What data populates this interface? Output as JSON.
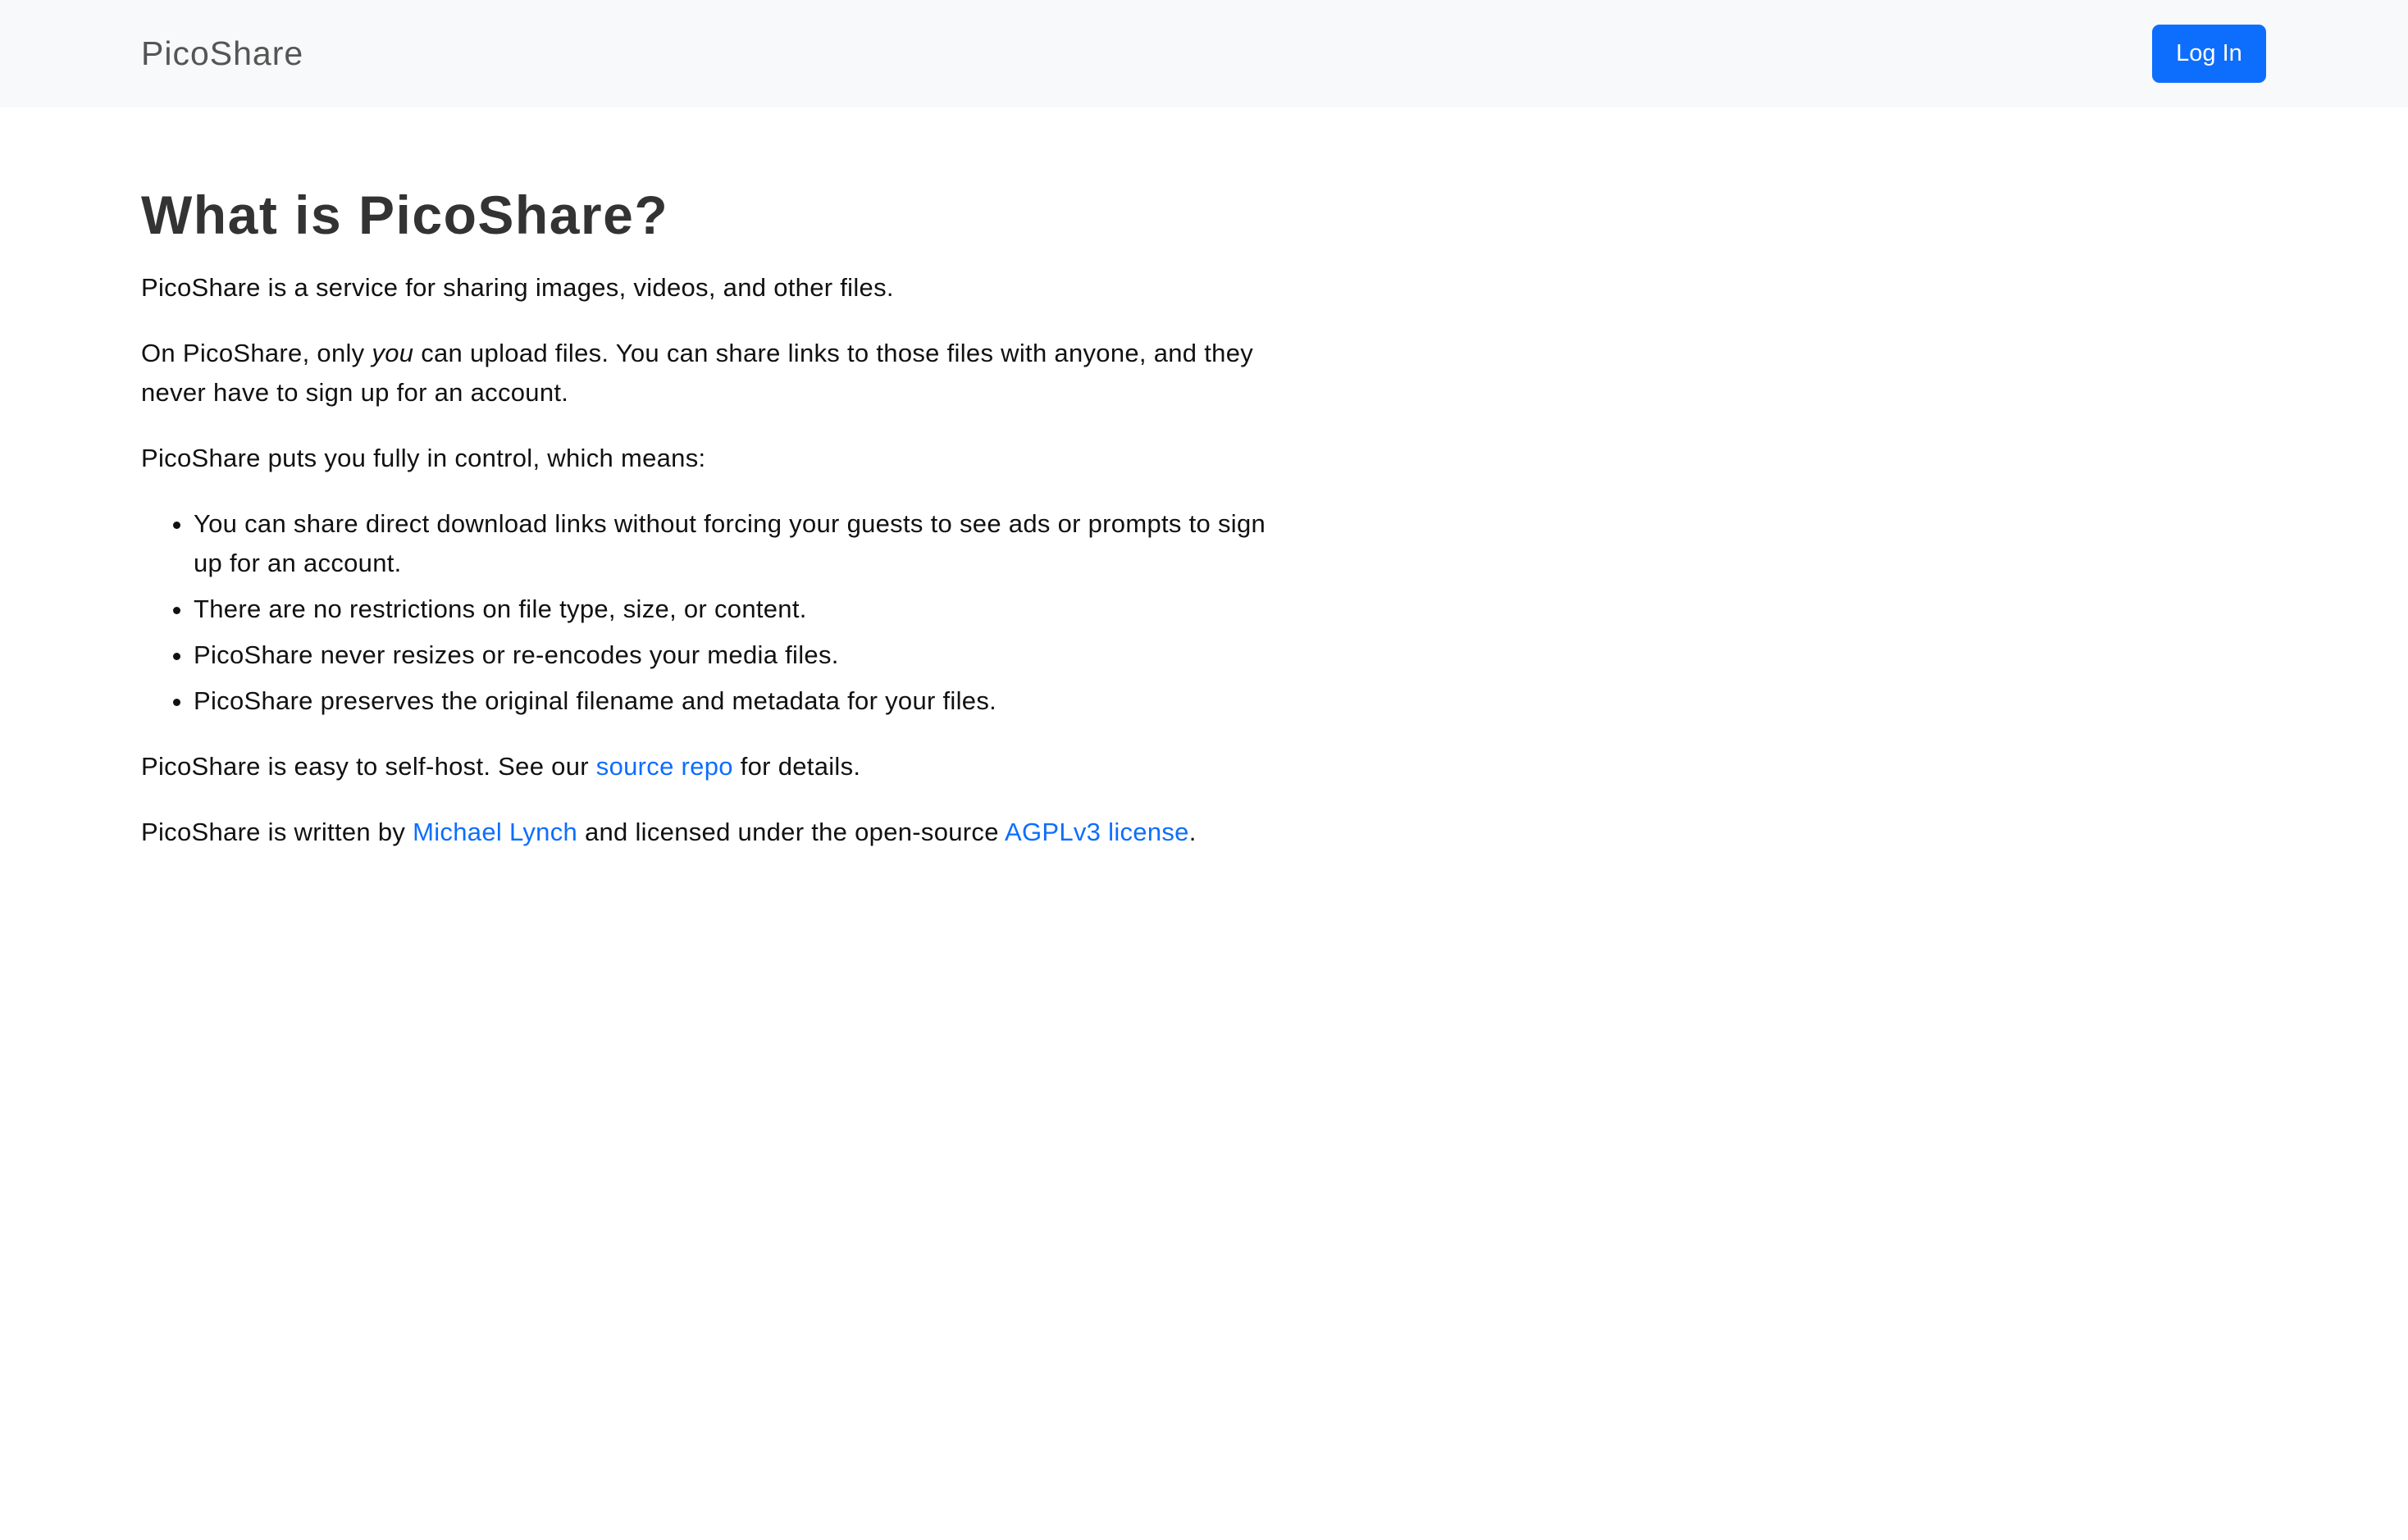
{
  "navbar": {
    "brand": "PicoShare",
    "login_label": "Log In"
  },
  "about": {
    "heading": "What is PicoShare?",
    "intro": "PicoShare is a service for sharing images, videos, and other files.",
    "upload_before": "On PicoShare, only ",
    "upload_emphasis": "you",
    "upload_after": " can upload files. You can share links to those files with anyone, and they never have to sign up for an account.",
    "control_intro": "PicoShare puts you fully in control, which means:",
    "features": [
      "You can share direct download links without forcing your guests to see ads or prompts to sign up for an account.",
      "There are no restrictions on file type, size, or content.",
      "PicoShare never resizes or re-encodes your media files.",
      "PicoShare preserves the original filename and metadata for your files."
    ],
    "selfhost_before": "PicoShare is easy to self-host. See our ",
    "selfhost_link": "source repo",
    "selfhost_after": " for details.",
    "credits_before": "PicoShare is written by ",
    "author_link": "Michael Lynch",
    "credits_middle": " and licensed under the open-source ",
    "license_link": "AGPLv3 license",
    "credits_after": "."
  },
  "colors": {
    "navbar_bg": "#f8f9fa",
    "primary": "#0d6efd",
    "heading": "#333333",
    "text": "#111111"
  }
}
